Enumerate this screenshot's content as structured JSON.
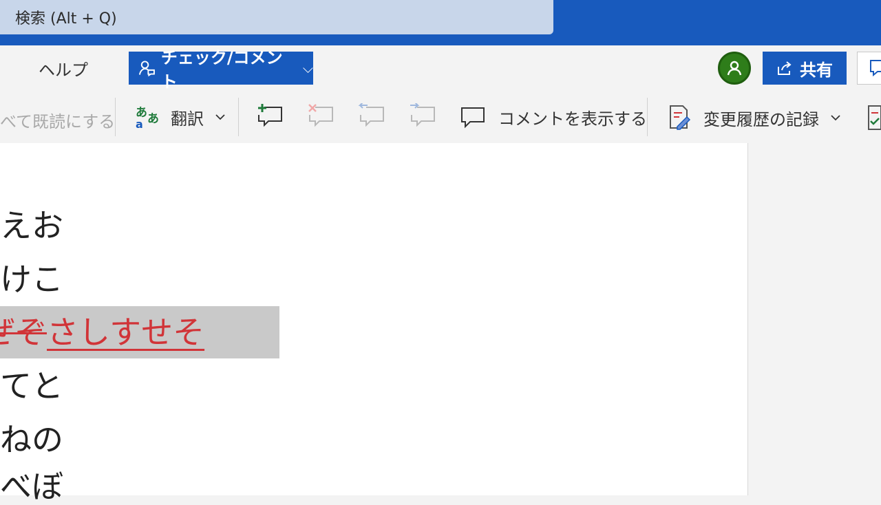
{
  "search": {
    "placeholder": "検索 (Alt + Q)"
  },
  "tabs": {
    "help": "ヘルプ",
    "review": "チェック/コメント"
  },
  "header": {
    "share": "共有"
  },
  "toolbar": {
    "mark_read": "べて既読にする",
    "translate": "翻訳",
    "show_comments": "コメントを表示する",
    "track_changes": "変更履歴の記録"
  },
  "document": {
    "lines": [
      "えお",
      "けこ",
      "てと",
      "ねの",
      "べぼ"
    ],
    "deleted_text": "ぜぞ",
    "inserted_text": "さしすせそ"
  },
  "colors": {
    "brand": "#185abd",
    "revision": "#d13438",
    "avatar": "#2e7d1a"
  }
}
